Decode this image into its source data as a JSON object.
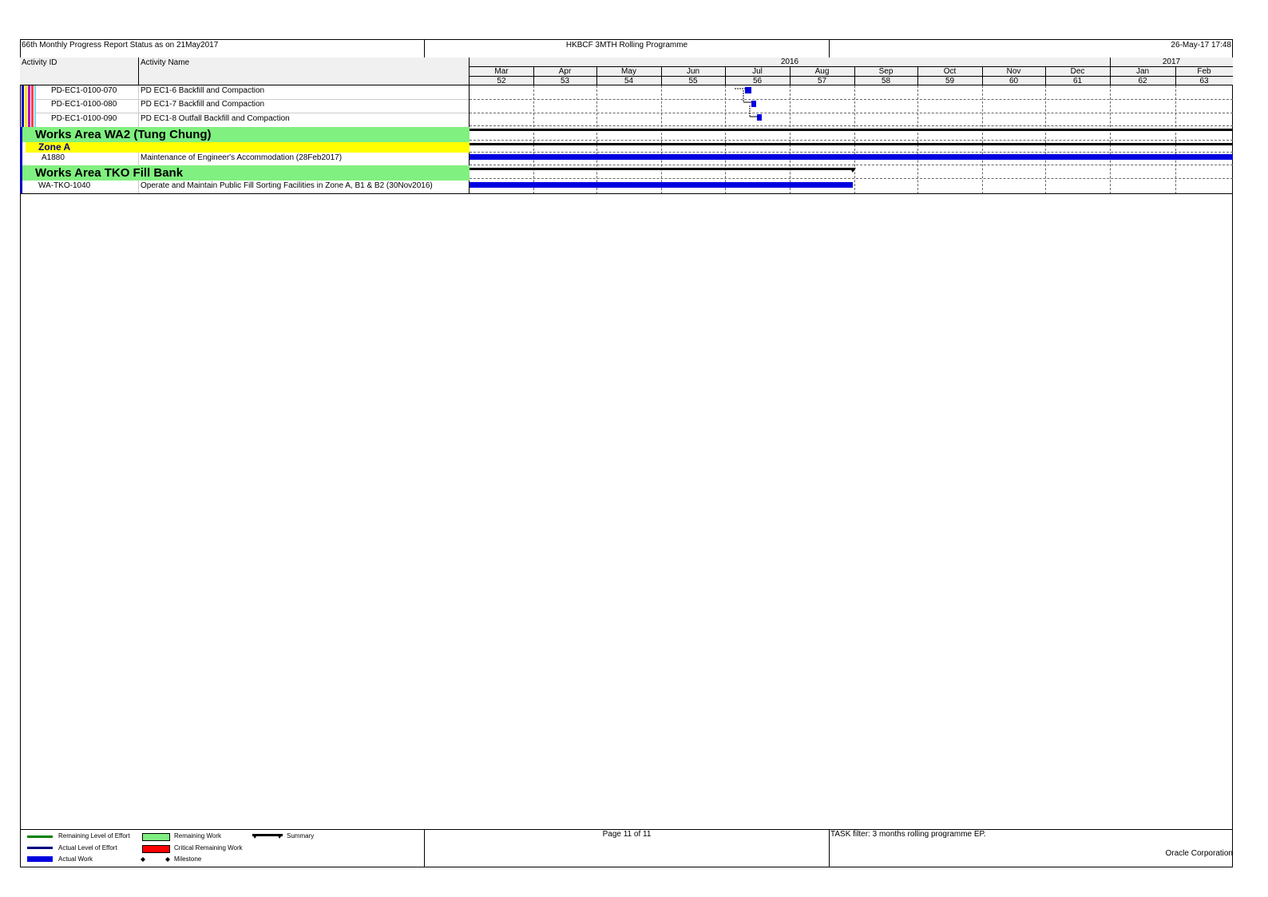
{
  "header": {
    "left": "66th Monthly Progress Report Status as on 21May2017",
    "center": "HKBCF 3MTH Rolling Programme",
    "right": "26-May-17 17:48"
  },
  "columns": {
    "activity_id": "Activity ID",
    "activity_name": "Activity Name"
  },
  "timescale": {
    "years": [
      "2016",
      "2017"
    ],
    "months": [
      {
        "label": "Mar",
        "week": "52"
      },
      {
        "label": "Apr",
        "week": "53"
      },
      {
        "label": "May",
        "week": "54"
      },
      {
        "label": "Jun",
        "week": "55"
      },
      {
        "label": "Jul",
        "week": "56"
      },
      {
        "label": "Aug",
        "week": "57"
      },
      {
        "label": "Sep",
        "week": "58"
      },
      {
        "label": "Oct",
        "week": "59"
      },
      {
        "label": "Nov",
        "week": "60"
      },
      {
        "label": "Dec",
        "week": "61"
      },
      {
        "label": "Jan",
        "week": "62"
      },
      {
        "label": "Feb",
        "week": "63"
      }
    ]
  },
  "rows": [
    {
      "type": "activity",
      "id": "PD-EC1-0100-070",
      "name": "PD EC1-6 Backfill and Compaction"
    },
    {
      "type": "activity",
      "id": "PD-EC1-0100-080",
      "name": "PD EC1-7 Backfill and Compaction"
    },
    {
      "type": "activity",
      "id": "PD-EC1-0100-090",
      "name": "PD EC1-8 Outfall Backfill and Compaction"
    },
    {
      "type": "wbs",
      "title": "Works Area WA2 (Tung Chung)"
    },
    {
      "type": "wbs2",
      "title": "Zone A"
    },
    {
      "type": "activity",
      "id": "A1880",
      "name": "Maintenance of Engineer's Accommodation (28Feb2017)"
    },
    {
      "type": "wbs",
      "title": "Works Area TKO Fill Bank"
    },
    {
      "type": "activity",
      "id": "WA-TKO-1040",
      "name": "Operate and Maintain Public Fill Sorting Facilities in Zone A, B1 & B2 (30Nov2016)"
    }
  ],
  "colors": {
    "wbs_green": "#80f080",
    "wbs_yellow": "#ffff00",
    "actual_work": "#0000e0",
    "summary": "#000000",
    "critical": "#ff0000",
    "remaining_work": "#80f080",
    "remaining_loe": "#008000",
    "actual_loe": "#000080"
  },
  "footer": {
    "page": "Page 11 of 11",
    "filter": "TASK filter: 3 months rolling programme EP.",
    "vendor": "Oracle Corporation"
  },
  "legend": [
    {
      "label": "Remaining Level of Effort",
      "icon": "remaining-loe-line"
    },
    {
      "label": "Actual Level of Effort",
      "icon": "actual-loe-line"
    },
    {
      "label": "Actual Work",
      "icon": "actual-work-bar"
    },
    {
      "label": "Remaining Work",
      "icon": "remaining-work-bar"
    },
    {
      "label": "Critical Remaining Work",
      "icon": "critical-work-bar"
    },
    {
      "label": "Milestone",
      "icon": "milestone-diamond"
    },
    {
      "label": "Summary",
      "icon": "summary-bar"
    }
  ]
}
